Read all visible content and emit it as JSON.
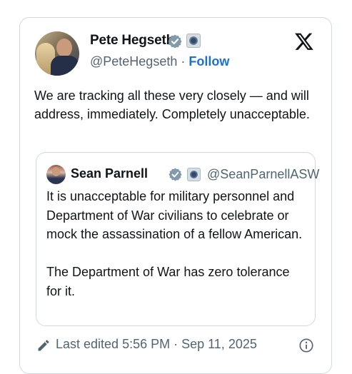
{
  "tweet": {
    "author": {
      "name": "Pete Hegseth",
      "handle": "@PeteHegseth",
      "separator": "·",
      "follow_label": "Follow"
    },
    "text": "We are tracking all these very closely — and will address, immediately. Completely unacceptable.",
    "quoted": {
      "name": "Sean Parnell",
      "handle": "@SeanParnellASW",
      "paragraphs": [
        "It is unacceptable for military personnel and Department of War civilians to celebrate or mock the assassination of a fellow American.",
        "The Department of War has zero tolerance for it."
      ]
    },
    "footer": {
      "edited_text": "Last edited 5:56 PM · Sep 11, 2025"
    }
  },
  "icons": {
    "verified": "verified-badge-icon",
    "affiliation": "government-affiliation-icon",
    "platform": "x-logo-icon",
    "edit": "pencil-icon",
    "info": "info-icon"
  },
  "colors": {
    "verified_badge": "#829aab",
    "follow_link": "#1d6fd1",
    "secondary_text": "#536471",
    "border": "#cfd9de"
  }
}
